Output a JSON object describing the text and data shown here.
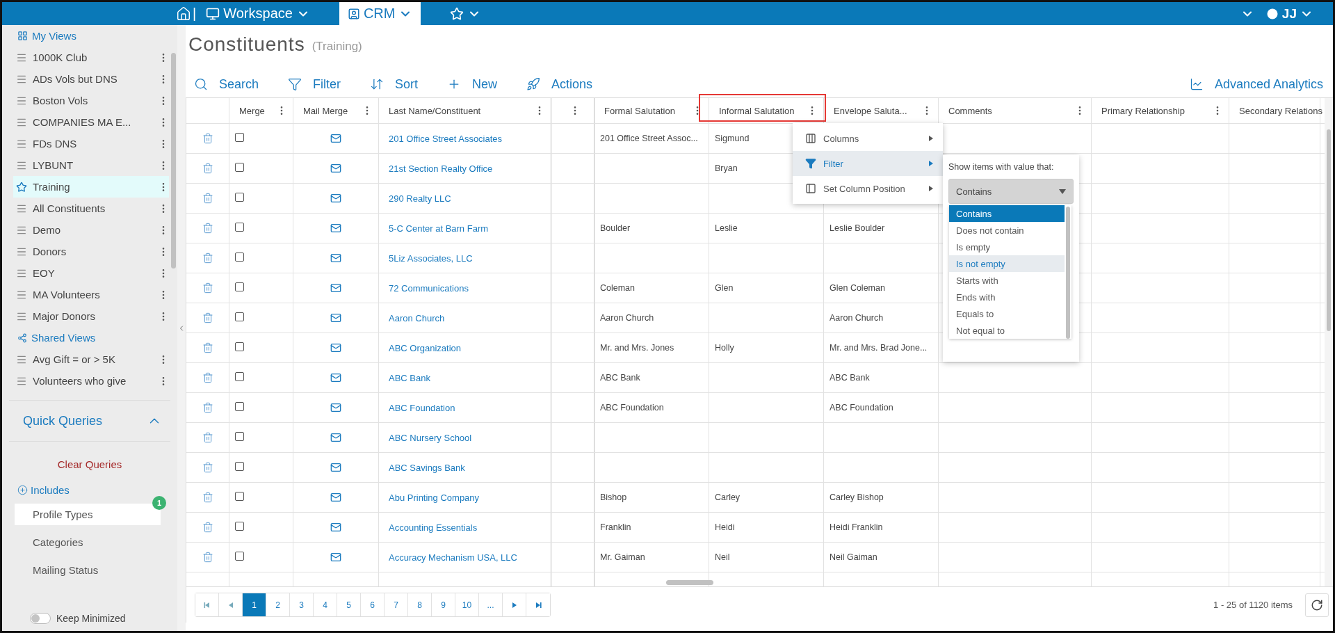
{
  "top_nav": {
    "separator": "|",
    "items": [
      {
        "kind": "workspace",
        "label": "Workspace",
        "selected": false
      },
      {
        "kind": "crm",
        "label": "CRM",
        "selected": true
      },
      {
        "kind": "favorites",
        "selected": false
      }
    ],
    "user": "JJ"
  },
  "sidebar": {
    "my_views": "My Views",
    "views": [
      {
        "label": "1000K Club",
        "selected": false
      },
      {
        "label": "ADs Vols but DNS",
        "selected": false
      },
      {
        "label": "Boston Vols",
        "selected": false
      },
      {
        "label": "COMPANIES MA E...",
        "selected": false
      },
      {
        "label": "FDs DNS",
        "selected": false
      },
      {
        "label": "LYBUNT",
        "selected": false
      },
      {
        "label": "Training",
        "selected": true
      },
      {
        "label": "All Constituents",
        "selected": false
      },
      {
        "label": "Demo",
        "selected": false
      },
      {
        "label": "Donors",
        "selected": false
      },
      {
        "label": "EOY",
        "selected": false
      },
      {
        "label": "MA Volunteers",
        "selected": false
      },
      {
        "label": "Major Donors",
        "selected": false
      }
    ],
    "shared_views": "Shared Views",
    "shared": [
      {
        "label": "Avg Gift = or > 5K",
        "selected": false
      },
      {
        "label": "Volunteers who give",
        "selected": false
      }
    ],
    "quick_queries": {
      "title": "Quick Queries",
      "expanded": true,
      "clear": "Clear Queries",
      "includes": "Includes",
      "items": [
        {
          "label": "Profile Types",
          "badge": "1",
          "active": true
        },
        {
          "label": "Categories",
          "active": false
        },
        {
          "label": "Mailing Status",
          "active": false
        }
      ]
    },
    "keep_minimized": {
      "label": "Keep Minimized",
      "on": false
    }
  },
  "page": {
    "title": "Constituents",
    "subtitle": "(Training)"
  },
  "toolbar": [
    {
      "kind": "search",
      "label": "Search"
    },
    {
      "kind": "filter",
      "label": "Filter"
    },
    {
      "kind": "sort",
      "label": "Sort"
    },
    {
      "kind": "new",
      "label": "New"
    },
    {
      "kind": "actions",
      "label": "Actions"
    }
  ],
  "analytics": "Advanced Analytics",
  "table": {
    "columns": [
      {
        "kind": "actions"
      },
      {
        "kind": "text",
        "label": "Merge"
      },
      {
        "kind": "text",
        "label": "Mail Merge"
      },
      {
        "kind": "text",
        "label": "Last Name/Constituent"
      },
      {
        "kind": "untitled"
      },
      {
        "kind": "text",
        "label": "Formal Salutation"
      },
      {
        "kind": "text",
        "label": "Informal Salutation",
        "highlighted": true
      },
      {
        "kind": "text",
        "label": "Envelope Saluta..."
      },
      {
        "kind": "text",
        "label": "Comments"
      },
      {
        "kind": "text",
        "label": "Primary Relationship"
      },
      {
        "kind": "text",
        "label": "Secondary Relations"
      }
    ],
    "rows": [
      {
        "name": "201 Office Street Associates",
        "formal": "201 Office Street Assoc...",
        "informal": "Sigmund",
        "checked": false
      },
      {
        "name": "21st Section Realty Office",
        "informal": "Bryan",
        "checked": false
      },
      {
        "name": "290 Realty LLC",
        "checked": false
      },
      {
        "name": "5-C Center at Barn Farm",
        "formal": "Boulder",
        "informal": "Leslie",
        "envelope": "Leslie Boulder",
        "checked": false
      },
      {
        "name": "5Liz Associates, LLC",
        "checked": false
      },
      {
        "name": "72 Communications",
        "formal": "Coleman",
        "informal": "Glen",
        "envelope": "Glen Coleman",
        "checked": false
      },
      {
        "name": "Aaron Church",
        "formal": "Aaron Church",
        "envelope": "Aaron Church",
        "checked": false
      },
      {
        "name": "ABC Organization",
        "formal": "Mr. and Mrs. Jones",
        "informal": "Holly",
        "envelope": "Mr. and Mrs. Brad Jone...",
        "checked": false
      },
      {
        "name": "ABC Bank",
        "formal": "ABC Bank",
        "envelope": "ABC Bank",
        "checked": false
      },
      {
        "name": "ABC Foundation",
        "formal": "ABC Foundation",
        "envelope": "ABC Foundation",
        "checked": false
      },
      {
        "name": "ABC Nursery School",
        "checked": false
      },
      {
        "name": "ABC Savings Bank",
        "checked": false
      },
      {
        "name": "Abu Printing Company",
        "formal": "Bishop",
        "informal": "Carley",
        "envelope": "Carley Bishop",
        "checked": false
      },
      {
        "name": "Accounting Essentials",
        "formal": "Franklin",
        "informal": "Heidi",
        "envelope": "Heidi Franklin",
        "checked": false
      },
      {
        "name": "Accuracy Mechanism USA, LLC",
        "formal": "Mr. Gaiman",
        "informal": "Neil",
        "envelope": "Neil Gaiman",
        "checked": false
      }
    ]
  },
  "column_menu": {
    "items": [
      {
        "kind": "columns",
        "label": "Columns",
        "selected": false
      },
      {
        "kind": "filter",
        "label": "Filter",
        "selected": true
      },
      {
        "kind": "position",
        "label": "Set Column Position",
        "selected": false
      }
    ],
    "filter": {
      "prompt": "Show items with value that:",
      "value": "Contains",
      "options": [
        {
          "label": "Contains",
          "selected": true,
          "hovered": false
        },
        {
          "label": "Does not contain",
          "selected": false,
          "hovered": false
        },
        {
          "label": "Is empty",
          "selected": false,
          "hovered": false
        },
        {
          "label": "Is not empty",
          "selected": false,
          "hovered": true
        },
        {
          "label": "Starts with",
          "selected": false,
          "hovered": false
        },
        {
          "label": "Ends with",
          "selected": false,
          "hovered": false
        },
        {
          "label": "Equals to",
          "selected": false,
          "hovered": false
        },
        {
          "label": "Not equal to",
          "selected": false,
          "hovered": false
        }
      ]
    }
  },
  "pager": {
    "pages": [
      {
        "label": "1",
        "selected": true
      },
      {
        "label": "2",
        "selected": false
      },
      {
        "label": "3",
        "selected": false
      },
      {
        "label": "4",
        "selected": false
      },
      {
        "label": "5",
        "selected": false
      },
      {
        "label": "6",
        "selected": false
      },
      {
        "label": "7",
        "selected": false
      },
      {
        "label": "8",
        "selected": false
      },
      {
        "label": "9",
        "selected": false
      },
      {
        "label": "10",
        "selected": false
      },
      {
        "label": "...",
        "selected": false
      }
    ],
    "summary": "1 - 25 of 1120 items"
  }
}
